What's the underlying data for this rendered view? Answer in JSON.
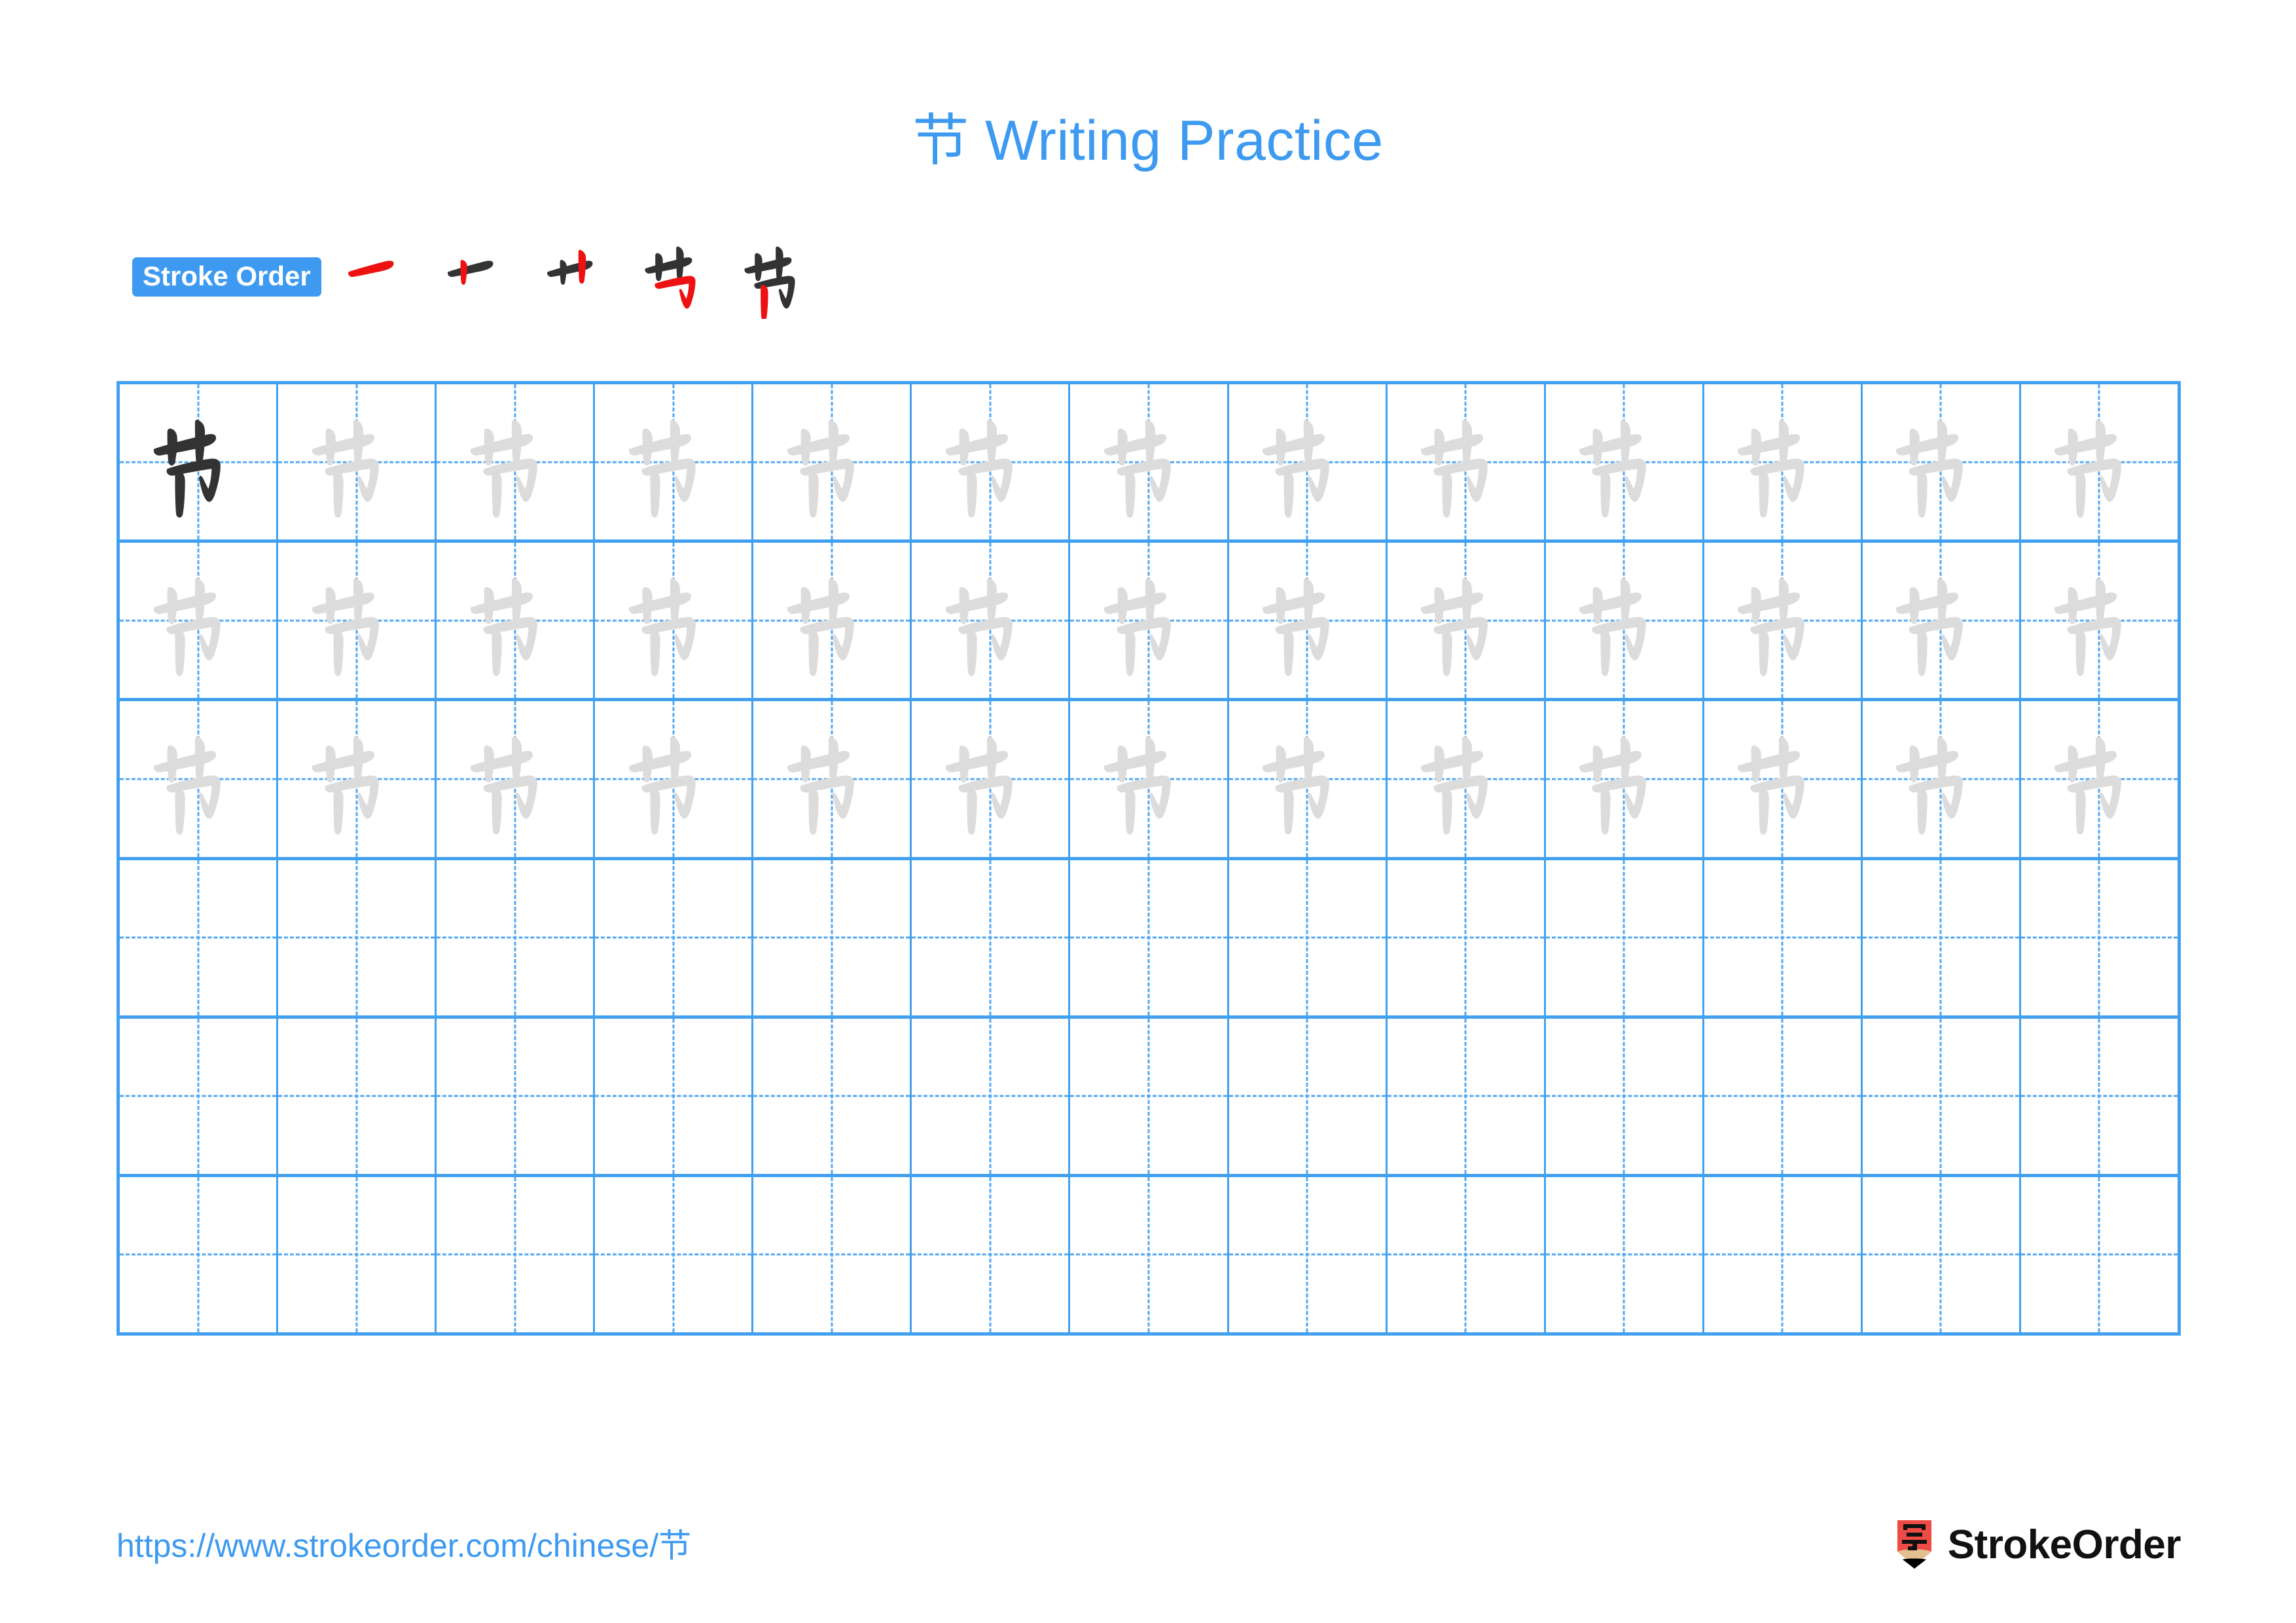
{
  "page": {
    "character": "节",
    "title": "节 Writing Practice",
    "background_color": "#ffffff"
  },
  "colors": {
    "accent_blue": "#3d9af0",
    "grid_line_blue": "#42a0f0",
    "guide_dash_blue": "#53a8f2",
    "trace_gray": "#dcdcdc",
    "model_black": "#333333",
    "stroke_highlight_red": "#ee1111",
    "logo_red": "#ee4b44",
    "logo_wood": "#e3be90"
  },
  "stroke_order": {
    "badge_label": "Stroke Order",
    "total_strokes": 5,
    "steps": [
      {
        "index": 1,
        "name": "stroke-step-1",
        "new_stroke": "héng (horizontal)"
      },
      {
        "index": 2,
        "name": "stroke-step-2",
        "new_stroke": "shù (vertical)"
      },
      {
        "index": 3,
        "name": "stroke-step-3",
        "new_stroke": "shù (vertical)"
      },
      {
        "index": 4,
        "name": "stroke-step-4",
        "new_stroke": "héngzhégōu (horizontal-turn-hook)"
      },
      {
        "index": 5,
        "name": "stroke-step-5",
        "new_stroke": "shù (vertical)"
      }
    ]
  },
  "practice_grid": {
    "columns": 13,
    "rows": 6,
    "guide_style": "dashed cross",
    "cells": [
      [
        "model",
        "trace",
        "trace",
        "trace",
        "trace",
        "trace",
        "trace",
        "trace",
        "trace",
        "trace",
        "trace",
        "trace",
        "trace"
      ],
      [
        "trace",
        "trace",
        "trace",
        "trace",
        "trace",
        "trace",
        "trace",
        "trace",
        "trace",
        "trace",
        "trace",
        "trace",
        "trace"
      ],
      [
        "trace",
        "trace",
        "trace",
        "trace",
        "trace",
        "trace",
        "trace",
        "trace",
        "trace",
        "trace",
        "trace",
        "trace",
        "trace"
      ],
      [
        "empty",
        "empty",
        "empty",
        "empty",
        "empty",
        "empty",
        "empty",
        "empty",
        "empty",
        "empty",
        "empty",
        "empty",
        "empty"
      ],
      [
        "empty",
        "empty",
        "empty",
        "empty",
        "empty",
        "empty",
        "empty",
        "empty",
        "empty",
        "empty",
        "empty",
        "empty",
        "empty"
      ],
      [
        "empty",
        "empty",
        "empty",
        "empty",
        "empty",
        "empty",
        "empty",
        "empty",
        "empty",
        "empty",
        "empty",
        "empty",
        "empty"
      ]
    ]
  },
  "footer": {
    "url": "https://www.strokeorder.com/chinese/节",
    "brand_name": "StrokeOrder",
    "brand_mark_character": "字"
  }
}
